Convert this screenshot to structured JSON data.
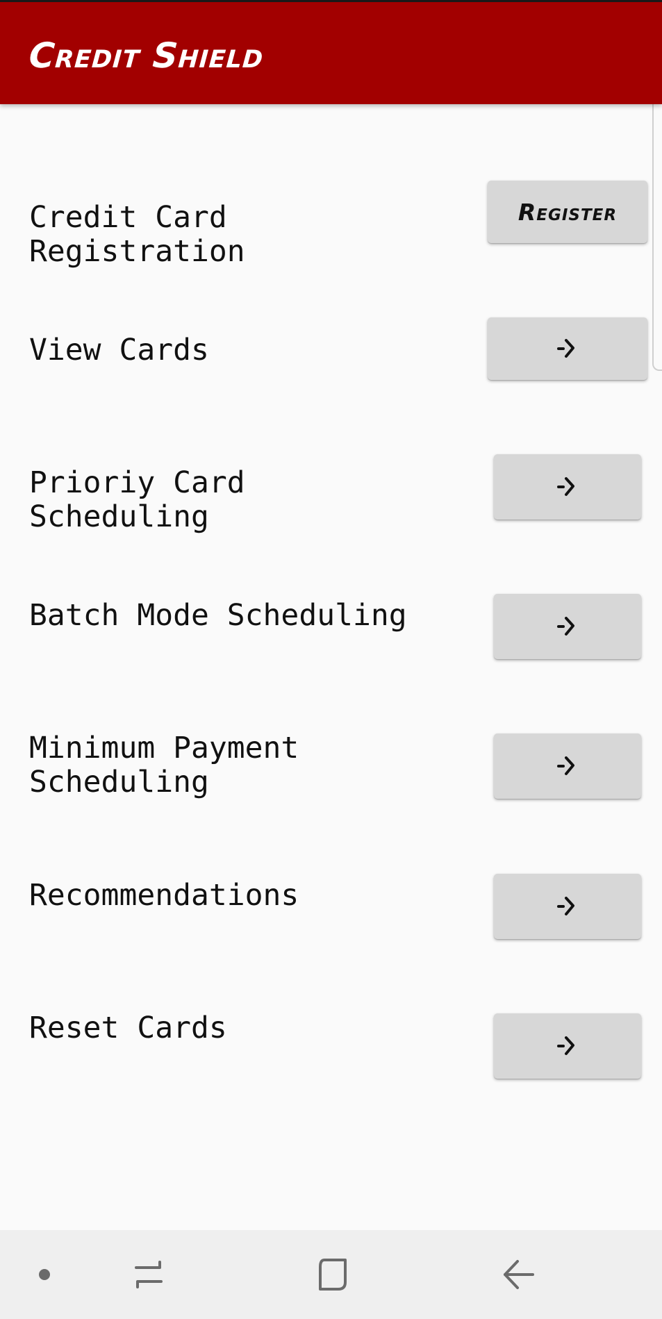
{
  "app_bar": {
    "title": "Credit Shield",
    "color": "#a20000"
  },
  "rows": [
    {
      "label": "Credit Card Registration",
      "button_text": "Register",
      "button_icon": "arrow-right-icon"
    },
    {
      "label": "View Cards",
      "button_text": "",
      "button_icon": "arrow-right-icon"
    },
    {
      "label": "Prioriy Card Scheduling",
      "button_text": "",
      "button_icon": "arrow-right-icon"
    },
    {
      "label": "Batch Mode Scheduling",
      "button_text": "",
      "button_icon": "arrow-right-icon"
    },
    {
      "label": "Minimum Payment Scheduling",
      "button_text": "",
      "button_icon": "arrow-right-icon"
    },
    {
      "label": "Recommendations",
      "button_text": "",
      "button_icon": "arrow-right-icon"
    },
    {
      "label": "Reset Cards",
      "button_text": "",
      "button_icon": "arrow-right-icon"
    }
  ],
  "nav_bar": {
    "items": [
      "dot-icon",
      "recents-icon",
      "home-icon",
      "back-icon"
    ]
  },
  "colors": {
    "background": "#fafafa",
    "button": "#d7d7d7",
    "nav_bar": "#efefef"
  }
}
